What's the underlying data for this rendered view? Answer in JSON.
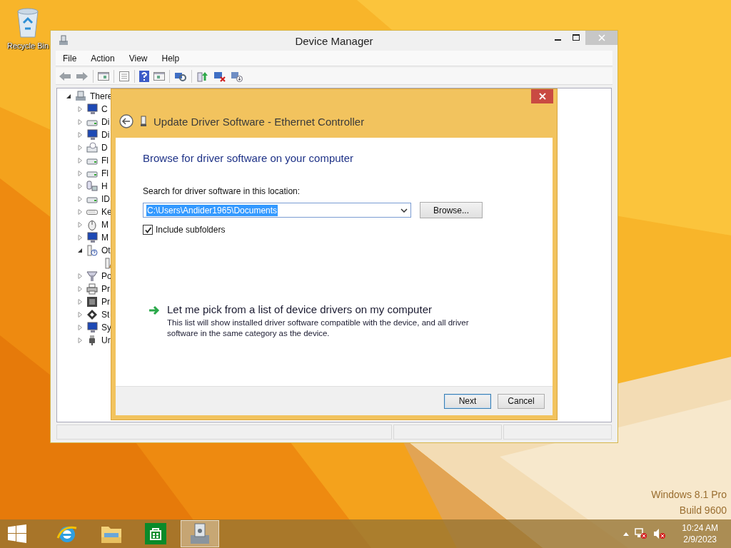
{
  "desktop": {
    "icons": [
      {
        "label": "Recycle Bin"
      }
    ],
    "watermark": [
      "Windows 8.1 Pro",
      "Build 9600"
    ]
  },
  "device_manager": {
    "title": "Device Manager",
    "menu": [
      "File",
      "Action",
      "View",
      "Help"
    ],
    "tree": {
      "label": "There",
      "kind": "computer",
      "expanded": true,
      "children": [
        {
          "label": "C",
          "kind": "monitor",
          "expanded": false
        },
        {
          "label": "Di",
          "kind": "drive",
          "expanded": false
        },
        {
          "label": "Di",
          "kind": "monitor",
          "expanded": false
        },
        {
          "label": "D",
          "kind": "disc",
          "expanded": false
        },
        {
          "label": "Fl",
          "kind": "drive",
          "expanded": false
        },
        {
          "label": "Fl",
          "kind": "drive",
          "expanded": false
        },
        {
          "label": "H",
          "kind": "hid",
          "expanded": false
        },
        {
          "label": "ID",
          "kind": "drive",
          "expanded": false
        },
        {
          "label": "Ke",
          "kind": "keyboard",
          "expanded": false
        },
        {
          "label": "M",
          "kind": "mouse",
          "expanded": false
        },
        {
          "label": "M",
          "kind": "monitor",
          "expanded": false
        },
        {
          "label": "Ot",
          "kind": "unknown",
          "expanded": true,
          "children": [
            {
              "kind": "warning"
            }
          ]
        },
        {
          "label": "Po",
          "kind": "port",
          "expanded": false
        },
        {
          "label": "Pr",
          "kind": "printer",
          "expanded": false
        },
        {
          "label": "Pr",
          "kind": "chip",
          "expanded": false
        },
        {
          "label": "St",
          "kind": "storage",
          "expanded": false
        },
        {
          "label": "Sy",
          "kind": "monitor",
          "expanded": false
        },
        {
          "label": "Ur",
          "kind": "usb",
          "expanded": false
        }
      ]
    }
  },
  "dialog": {
    "title": "Update Driver Software - Ethernet Controller",
    "heading": "Browse for driver software on your computer",
    "location_label": "Search for driver software in this location:",
    "location": {
      "value": "C:\\Users\\Andider1965\\Documents",
      "selected": true
    },
    "browse_button": "Browse...",
    "include_subfolders": {
      "label": "Include subfolders",
      "checked": true
    },
    "pick_option": {
      "title": "Let me pick from a list of device drivers on my computer",
      "description": "This list will show installed driver software compatible with the device, and all driver software in the same category as the device."
    },
    "buttons": [
      {
        "label": "Next",
        "default": true
      },
      {
        "label": "Cancel",
        "default": false
      }
    ]
  },
  "taskbar": {
    "apps": [
      {
        "kind": "browser",
        "selected": false
      },
      {
        "kind": "folder",
        "selected": false
      },
      {
        "kind": "store",
        "selected": false
      },
      {
        "kind": "device-manager",
        "selected": true
      }
    ],
    "time": "10:24 AM",
    "date": "2/9/2023"
  }
}
